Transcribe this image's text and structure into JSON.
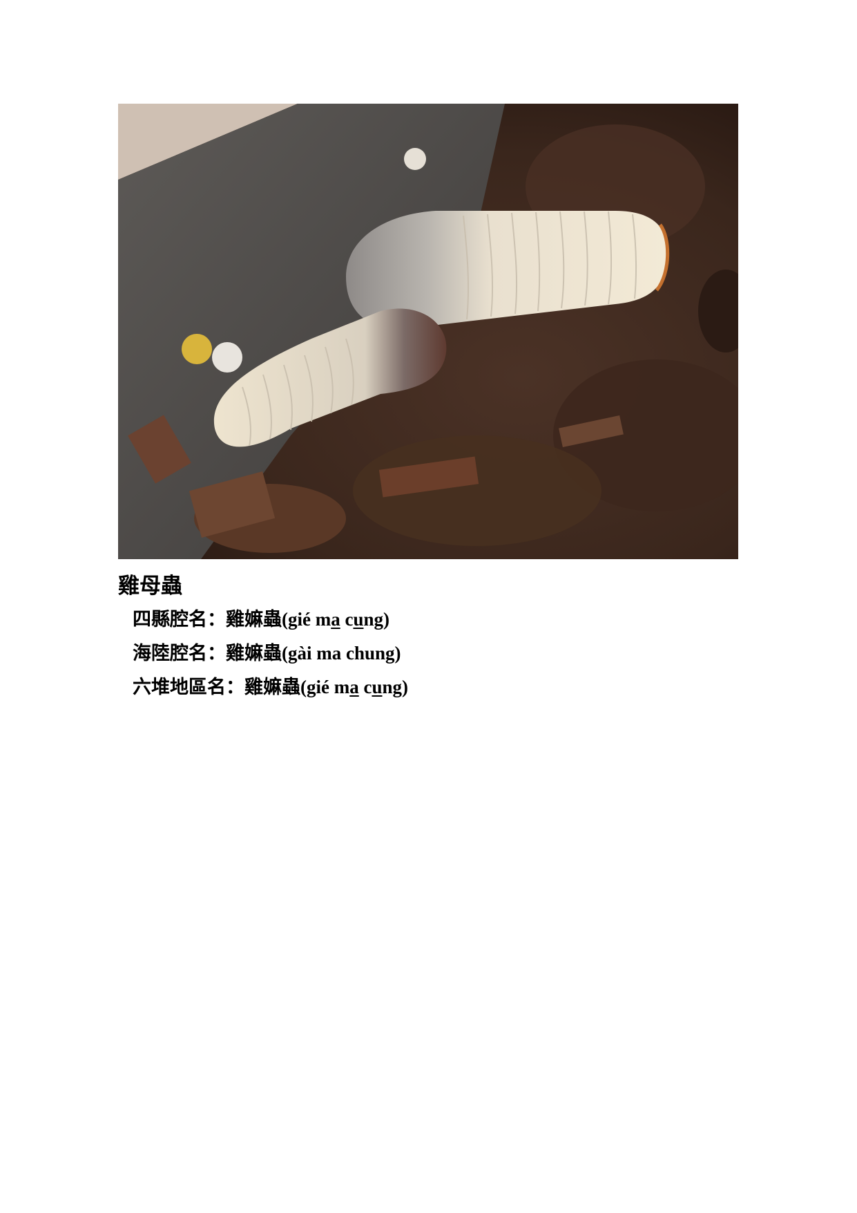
{
  "photo": {
    "subject": "grub-larvae-in-soil"
  },
  "title": "雞母蟲",
  "entries": [
    {
      "label": "四縣腔名：",
      "name": "雞嫲蟲",
      "pron_open": "(gié m",
      "pron_u1": "a",
      "pron_mid": " c",
      "pron_u2": "u",
      "pron_close": "ng)"
    },
    {
      "label": "海陸腔名：",
      "name": "雞嫲蟲",
      "pron_full": "(gài ma chung)"
    },
    {
      "label": "六堆地區名：",
      "name": "雞嫲蟲",
      "pron_open": "(gié m",
      "pron_u1": "a",
      "pron_mid": " c",
      "pron_u2": "u",
      "pron_close": "ng)"
    }
  ]
}
